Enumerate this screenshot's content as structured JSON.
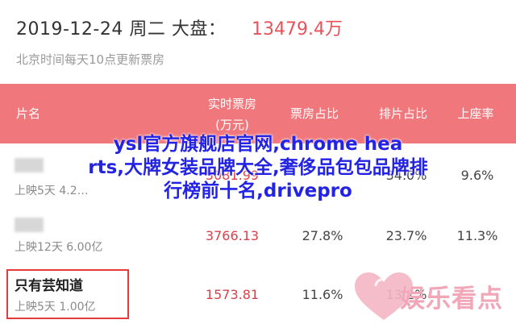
{
  "header": {
    "date_line": "2019-12-24 周二 大盘：",
    "total": "13479.4万",
    "note": "北京时间每天10点更新票房"
  },
  "table": {
    "columns": {
      "name": "片名",
      "realtime_line1": "实时票房",
      "realtime_line2": "(万元)",
      "box_share": "票房占比",
      "screen_share": "排片占比",
      "occupancy": "上座率"
    },
    "rows": [
      {
        "title": "",
        "days_sub": "上映5天  4.2…",
        "realtime": "5081.99",
        "box_share": "",
        "screen_share": "34.0%",
        "occupancy": "9.6%"
      },
      {
        "title": "",
        "days_sub": "上映12天  6.00亿",
        "realtime": "3766.13",
        "box_share": "27.8%",
        "screen_share": "23.7%",
        "occupancy": "11.3%"
      },
      {
        "title": "只有芸知道",
        "days_sub": "上映5天  1.00亿",
        "realtime": "1573.81",
        "box_share": "11.6%",
        "screen_share": "13.1%",
        "occupancy": ""
      }
    ]
  },
  "overlay": {
    "line1": "ysl官方旗舰店官网,chrome hea",
    "line2": "rts,大牌女装品牌大全,奢侈品包包品牌排",
    "line3": "行榜前十名,drivepro"
  },
  "watermark": {
    "text": "娱乐看点"
  },
  "colors": {
    "header_bar": "#f0787c",
    "accent_red": "#e8535b",
    "overlay_blue": "#2323e6",
    "watermark_pink": "#f1a7b8"
  }
}
